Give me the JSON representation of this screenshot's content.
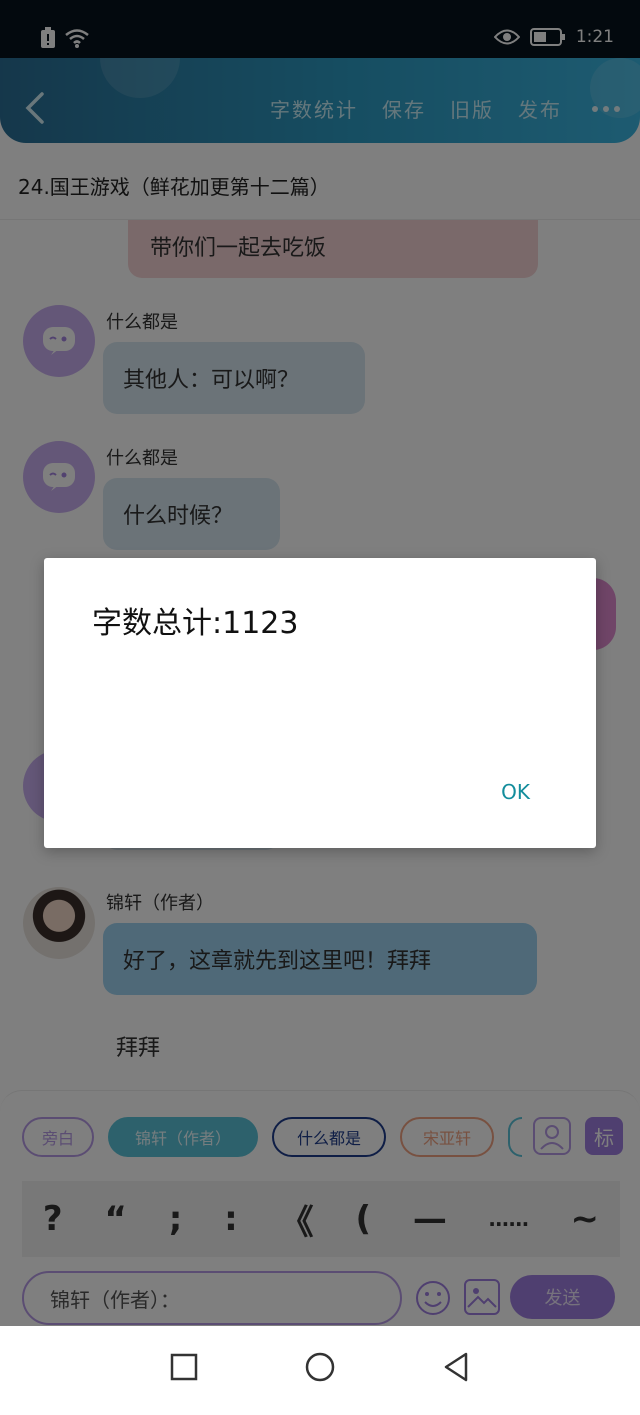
{
  "status_bar": {
    "time": "1:21"
  },
  "header": {
    "actions": [
      "字数统计",
      "保存",
      "旧版",
      "发布"
    ]
  },
  "chapter": {
    "title": "24.国王游戏（鲜花加更第十二篇）"
  },
  "messages": {
    "top_bubble": "带你们一起去吃饭",
    "m1": {
      "speaker": "什么都是",
      "text": "其他人：可以啊？"
    },
    "m2": {
      "speaker": "什么都是",
      "text": "什么时候？"
    },
    "author": {
      "speaker": "锦轩（作者）",
      "text": "好了，这章就先到这里吧！拜拜"
    },
    "narration": "拜拜"
  },
  "composer": {
    "chips": [
      "旁白",
      "锦轩（作者）",
      "什么都是",
      "宋亚轩"
    ],
    "tag_button": "标",
    "punctuation": [
      "?",
      "“",
      ";",
      ":",
      "《",
      "(",
      "—",
      "……",
      "~"
    ],
    "input_value": "锦轩（作者）：",
    "send_label": "发送"
  },
  "dialog": {
    "message": "字数总计:1123",
    "ok_label": "OK"
  },
  "colors": {
    "header_start": "#2a6f96",
    "header_end": "#3bb6e2",
    "accent_purple": "#9f7fe0",
    "ok_teal": "#138d9c"
  },
  "icons": [
    "battery-alert-icon",
    "wifi-icon",
    "eye-icon",
    "battery-icon",
    "back-arrow-icon",
    "more-icon",
    "chat-avatar-icon",
    "role-icon",
    "emoji-icon",
    "image-icon",
    "nav-square-icon",
    "nav-circle-icon",
    "nav-triangle-icon"
  ]
}
